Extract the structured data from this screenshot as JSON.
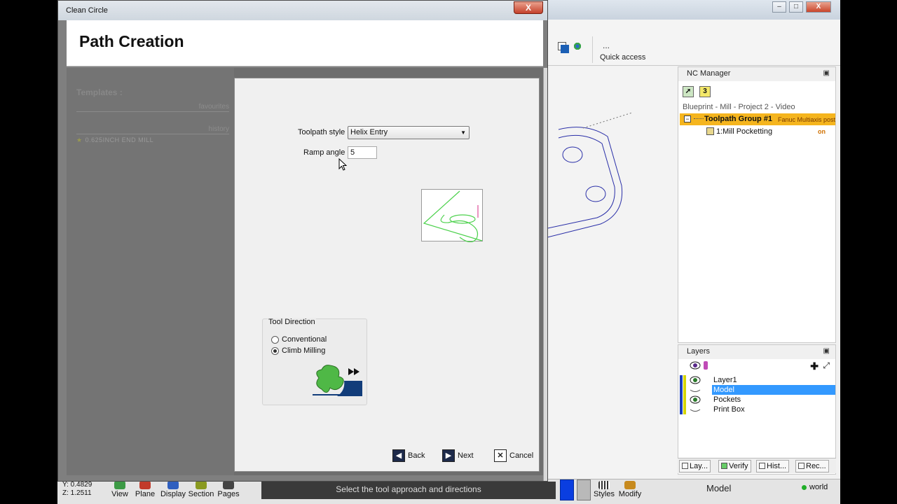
{
  "dialog": {
    "title": "Clean Circle",
    "close_label": "X",
    "heading": "Path Creation",
    "templates": {
      "title": "Templates :",
      "favourites_label": "favourites",
      "history_label": "history",
      "items": [
        "0.625INCH END MILL"
      ]
    },
    "options": {
      "toolpath_style_label": "Toolpath style :",
      "toolpath_style_value": "Helix Entry",
      "ramp_angle_label": "Ramp angle :",
      "ramp_angle_value": "5"
    },
    "tool_direction": {
      "label": "Tool Direction",
      "conventional_label": "Conventional",
      "climb_label": "Climb Milling",
      "selected": "Climb Milling"
    },
    "buttons": {
      "back": "Back",
      "next": "Next",
      "cancel": "Cancel"
    }
  },
  "app": {
    "quick_access_dots": "...",
    "quick_access_label": "Quick access",
    "window_buttons": {
      "minimize": "–",
      "maximize": "□",
      "close": "X"
    },
    "mdi_buttons": {
      "minimize": "–",
      "restore": "❐",
      "close": "✕"
    }
  },
  "nc_manager": {
    "title": "NC Manager",
    "icon_count": "3",
    "project": "Blueprint - Mill - Project 2 - Video",
    "group_label": "Toolpath Group #1",
    "post_label": "Fanuc Multiaxis post",
    "operation_label": "1:Mill Pocketting",
    "operation_status": "on"
  },
  "layers": {
    "title": "Layers",
    "items": [
      {
        "name": "Layer1",
        "selected": false,
        "visible": true
      },
      {
        "name": "Model",
        "selected": true,
        "visible": false
      },
      {
        "name": "Pockets",
        "selected": false,
        "visible": true
      },
      {
        "name": "Print Box",
        "selected": false,
        "visible": false
      }
    ]
  },
  "panel_tabs": [
    "Lay...",
    "Verify",
    "Hist...",
    "Rec..."
  ],
  "statusbar": {
    "coord_y": "Y: 0.4829",
    "coord_z": "Z: 1.2511",
    "buttons": [
      "View",
      "Plane",
      "Display",
      "Section",
      "Pages"
    ],
    "prompt": "Select the tool approach and directions",
    "styles_label": "Styles",
    "modify_label": "Modify",
    "mode": "Model",
    "world": "world"
  },
  "colors": {
    "group_highlight": "#f5b51e",
    "selection_blue": "#3399ff",
    "preview_green": "#4bd14b",
    "helix_pink": "#e04e9a",
    "geometry_blue": "#2a2fa8"
  }
}
